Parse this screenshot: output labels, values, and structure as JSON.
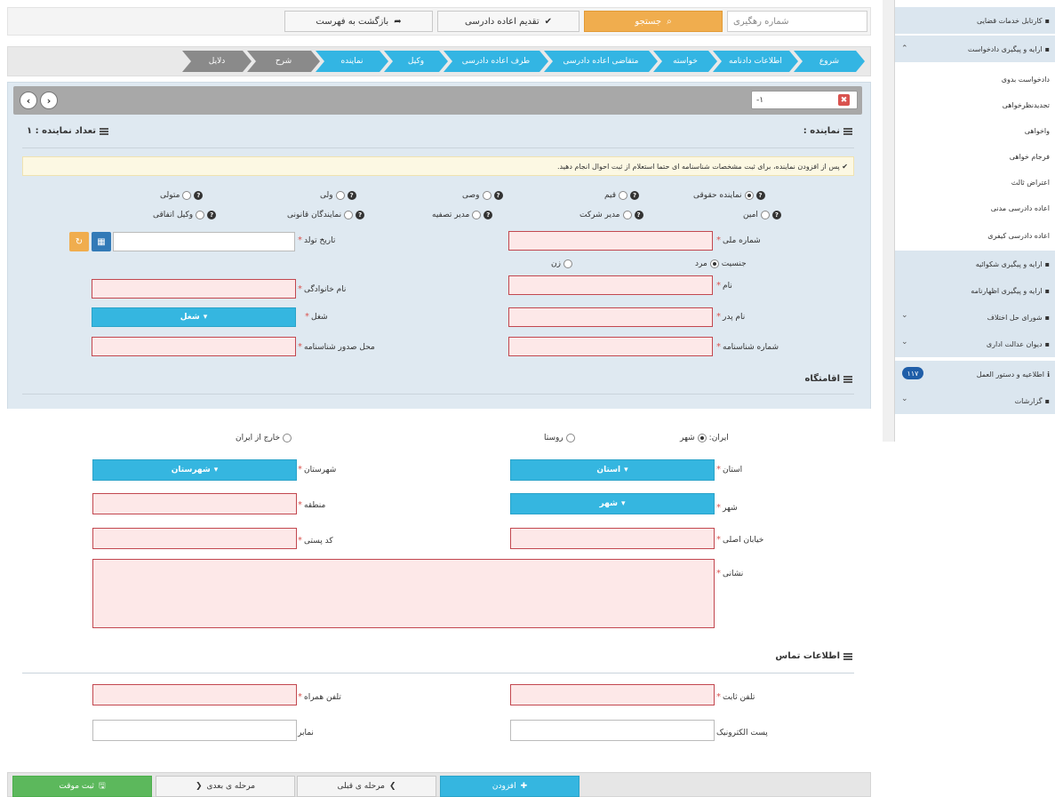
{
  "topbar": {
    "tracking_placeholder": "شماره رهگیری",
    "search_label": "جستجو",
    "submit_label": "تقدیم اعاده دادرسی",
    "back_label": "بازگشت به فهرست"
  },
  "steps": [
    "شروع",
    "اطلاعات دادنامه",
    "خواسته",
    "متقاضی اعاده دادرسی",
    "طرف اعاده دادرسی",
    "وکیل",
    "نماینده",
    "شرح",
    "دلایل"
  ],
  "panel": {
    "tab_label": "-۱",
    "section_title": "نماینده :",
    "count_label": "تعداد نماینده : ۱",
    "notice": "پس از افزودن نماینده، برای ثبت مشخصات شناسنامه ای حتما استعلام از ثبت احوال انجام دهید."
  },
  "rep_types": {
    "row1": [
      "نماینده حقوقی",
      "قیم",
      "وصی",
      "ولی",
      "متولی"
    ],
    "row2": [
      "امین",
      "مدیر شرکت",
      "مدیر تصفیه",
      "نمایندگان قانونی",
      "وکیل اتفاقی"
    ]
  },
  "person": {
    "national_code": "شماره ملی",
    "birth_date": "تاریخ تولد",
    "gender": "جنسیت",
    "male": "مرد",
    "female": "زن",
    "first_name": "نام",
    "last_name": "نام خانوادگی",
    "father_name": "نام پدر",
    "job": "شغل",
    "job_value": "شغل",
    "id_number": "شماره شناسنامه",
    "id_place": "محل صدور شناسنامه"
  },
  "residence": {
    "title": "اقامتگاه",
    "iran": "ایران:",
    "city_opt": "شهر",
    "village_opt": "روستا",
    "abroad_opt": "خارج از ایران",
    "province": "استان",
    "province_value": "استان",
    "county": "شهرستان",
    "county_value": "شهرستان",
    "city": "شهر",
    "city_value": "شهر",
    "region": "منطقه",
    "street": "خیابان اصلی",
    "postal_code": "کد پستی",
    "address": "نشانی"
  },
  "contact": {
    "title": "اطلاعات تماس",
    "phone": "تلفن ثابت",
    "mobile": "تلفن همراه",
    "email": "پست الکترونیک",
    "fax": "نمابر"
  },
  "bottom": {
    "add": "افزودن",
    "prev": "مرحله ی قبلی",
    "next": "مرحله ی بعدی",
    "save": "ثبت موقت"
  },
  "sidebar": {
    "items": [
      "کارتابل خدمات قضایی",
      "ارایه و پیگیری دادخواست",
      "دادخواست بدوی",
      "تجدیدنظرخواهی",
      "واخواهی",
      "فرجام خواهی",
      "اعتراض ثالث",
      "اعاده دادرسی مدنی",
      "اعاده دادرسی کیفری",
      "ارایه و پیگیری شکوائیه",
      "ارایه و پیگیری اظهارنامه",
      "شورای حل اختلاف",
      "دیوان عدالت اداری",
      "اطلاعیه و دستور العمل",
      "گزارشات"
    ],
    "badge": "۱۱۷"
  },
  "colors": {
    "accent": "#33b5e3",
    "search": "#f0ad4e",
    "save": "#5cb85c",
    "danger": "#d9534f"
  }
}
